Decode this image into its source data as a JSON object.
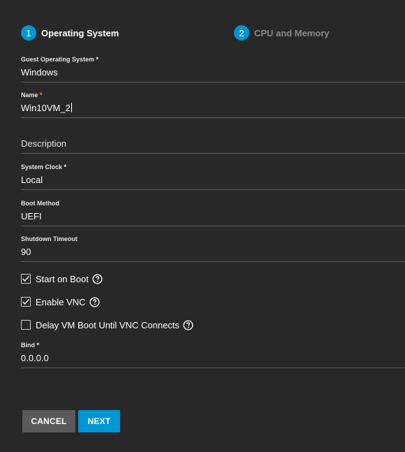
{
  "stepper": {
    "steps": [
      {
        "number": "1",
        "label": "Operating System"
      },
      {
        "number": "2",
        "label": "CPU and Memory"
      }
    ]
  },
  "form": {
    "guest_os": {
      "label": "Guest Operating System",
      "required": "*",
      "value": "Windows"
    },
    "name": {
      "label": "Name",
      "required": "*",
      "value": "Win10VM_2"
    },
    "description": {
      "placeholder": "Description"
    },
    "system_clock": {
      "label": "System Clock",
      "required": "*",
      "value": "Local"
    },
    "boot_method": {
      "label": "Boot Method",
      "value": "UEFI"
    },
    "shutdown_timeout": {
      "label": "Shutdown Timeout",
      "value": "90"
    },
    "start_on_boot": {
      "label": "Start on Boot",
      "checked": true
    },
    "enable_vnc": {
      "label": "Enable VNC",
      "checked": true
    },
    "delay_vm_boot": {
      "label": "Delay VM Boot Until VNC Connects",
      "checked": false
    },
    "bind": {
      "label": "Bind",
      "required": "*",
      "value": "0.0.0.0"
    }
  },
  "buttons": {
    "cancel": "CANCEL",
    "next": "NEXT"
  },
  "colors": {
    "background": "#282828",
    "accent": "#0095d5",
    "cancel_bg": "#5a5a5a",
    "required_focused": "#f5a623"
  }
}
